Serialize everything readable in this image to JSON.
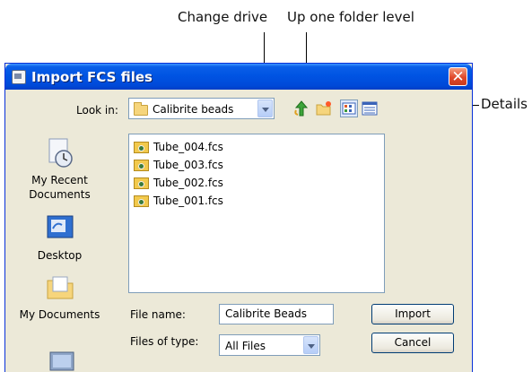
{
  "callouts": {
    "change_drive": "Change drive",
    "up_one_folder_level": "Up one folder level",
    "details": "Details"
  },
  "dialog": {
    "title": "Import FCS files",
    "look_in": {
      "label": "Look in:",
      "value": "Calibrite beads",
      "icon": "folder-icon"
    },
    "toolbar": [
      {
        "name": "up-one-level-button",
        "icon": "up-arrow-icon"
      },
      {
        "name": "new-folder-button",
        "icon": "new-folder-icon"
      },
      {
        "name": "list-view-button",
        "icon": "list-view-icon"
      },
      {
        "name": "details-view-button",
        "icon": "details-view-icon"
      }
    ],
    "places": [
      {
        "label": "My Recent Documents",
        "icon": "recent-documents-icon"
      },
      {
        "label": "Desktop",
        "icon": "desktop-icon"
      },
      {
        "label": "My Documents",
        "icon": "my-documents-icon"
      }
    ],
    "files": [
      "Tube_004.fcs",
      "Tube_003.fcs",
      "Tube_002.fcs",
      "Tube_001.fcs"
    ],
    "file_name": {
      "label": "File name:",
      "value": "Calibrite Beads"
    },
    "files_of_type": {
      "label": "Files of type:",
      "value": "All Files"
    },
    "import_label": "Import",
    "cancel_label": "Cancel"
  }
}
